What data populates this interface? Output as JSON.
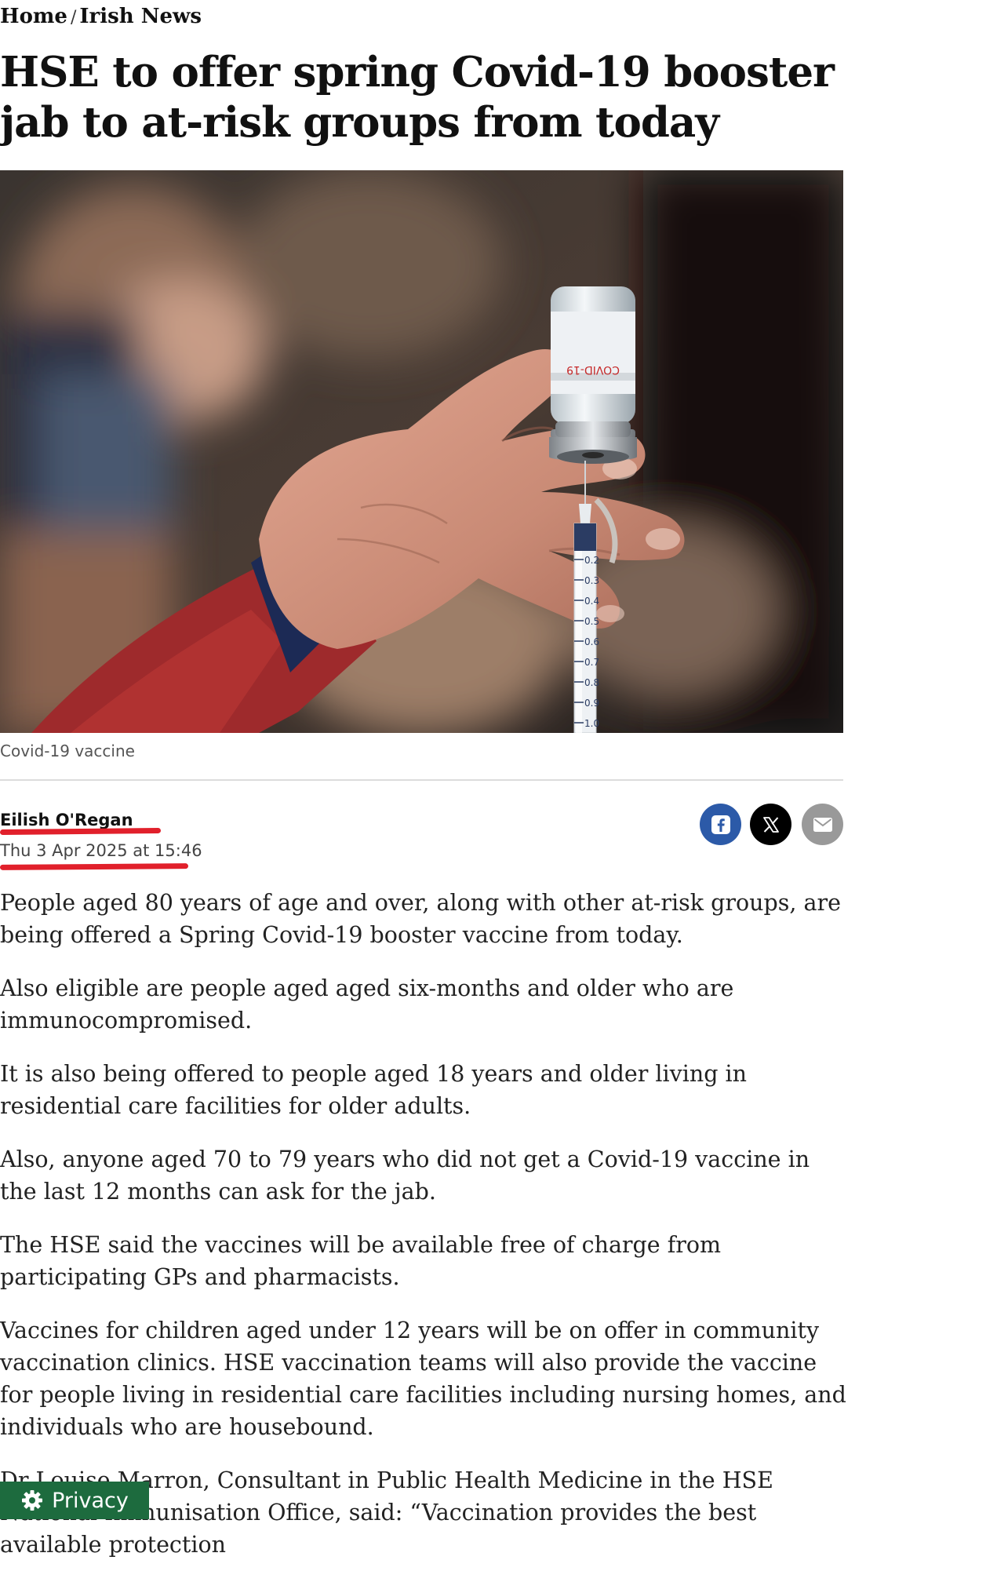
{
  "breadcrumb": {
    "home": "Home",
    "separator": "/",
    "section": "Irish News"
  },
  "article": {
    "headline": "HSE to offer spring Covid-19 booster jab to at-risk groups from today",
    "image_caption": "Covid-19 vaccine",
    "vial_label": "COVID-19",
    "syringe_marks": [
      "0.2",
      "0.3",
      "0.4",
      "0.5",
      "0.6",
      "0.7",
      "0.8",
      "0.9",
      "1.0"
    ],
    "author": "Eilish O'Regan",
    "published": "Thu 3 Apr 2025 at 15:46",
    "paragraphs": [
      "People aged 80 years of age and over, along with other at-risk groups, are being offered a Spring Covid-19 booster vaccine from today.",
      "Also eligible are people aged aged six-months and older who are immunocompromised.",
      "It is also being offered to people aged 18 years and older living in residential care facilities for older adults.",
      "Also, anyone aged 70 to 79 years who did not get a Covid-19 vaccine in the last 12 months can ask for the jab.",
      "The HSE said the vaccines will be available free of charge from participating GPs and pharmacists.",
      "Vaccines for children aged under 12 years will be on offer in community vaccination clinics. HSE vaccination teams will also provide the vaccine for people living in residential care facilities including nursing homes, and individuals who are housebound.",
      "Dr Louise Marron, Consultant in Public Health Medicine in the HSE National Immunisation Office, said: “Vaccination provides the best available protection"
    ]
  },
  "share": {
    "icons": [
      "facebook-icon",
      "x-icon",
      "mail-icon"
    ]
  },
  "privacy": {
    "label": "Privacy",
    "icon": "gear-icon"
  },
  "colors": {
    "annotation_red": "#e1202b",
    "facebook_blue": "#2c5aa8",
    "privacy_green": "#1d6b3e"
  }
}
